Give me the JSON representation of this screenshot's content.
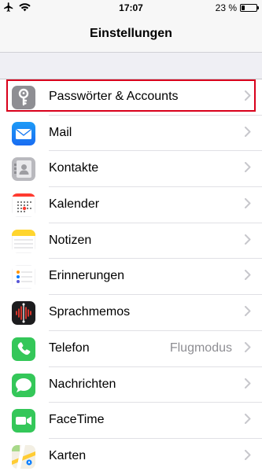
{
  "status_bar": {
    "time": "17:07",
    "battery_text": "23 %",
    "battery_level": 0.23
  },
  "nav": {
    "title": "Einstellungen"
  },
  "settings": [
    {
      "label": "Passwörter & Accounts",
      "icon": "key-icon",
      "value": ""
    },
    {
      "label": "Mail",
      "icon": "mail-icon",
      "value": ""
    },
    {
      "label": "Kontakte",
      "icon": "contacts-icon",
      "value": ""
    },
    {
      "label": "Kalender",
      "icon": "calendar-icon",
      "value": ""
    },
    {
      "label": "Notizen",
      "icon": "notes-icon",
      "value": ""
    },
    {
      "label": "Erinnerungen",
      "icon": "reminders-icon",
      "value": ""
    },
    {
      "label": "Sprachmemos",
      "icon": "voice-memos-icon",
      "value": ""
    },
    {
      "label": "Telefon",
      "icon": "phone-icon",
      "value": "Flugmodus"
    },
    {
      "label": "Nachrichten",
      "icon": "messages-icon",
      "value": ""
    },
    {
      "label": "FaceTime",
      "icon": "facetime-icon",
      "value": ""
    },
    {
      "label": "Karten",
      "icon": "maps-icon",
      "value": ""
    }
  ],
  "colors": {
    "highlight": "#d9001b",
    "chevron": "#c7c7cc",
    "secondary_text": "#8e8e93"
  }
}
